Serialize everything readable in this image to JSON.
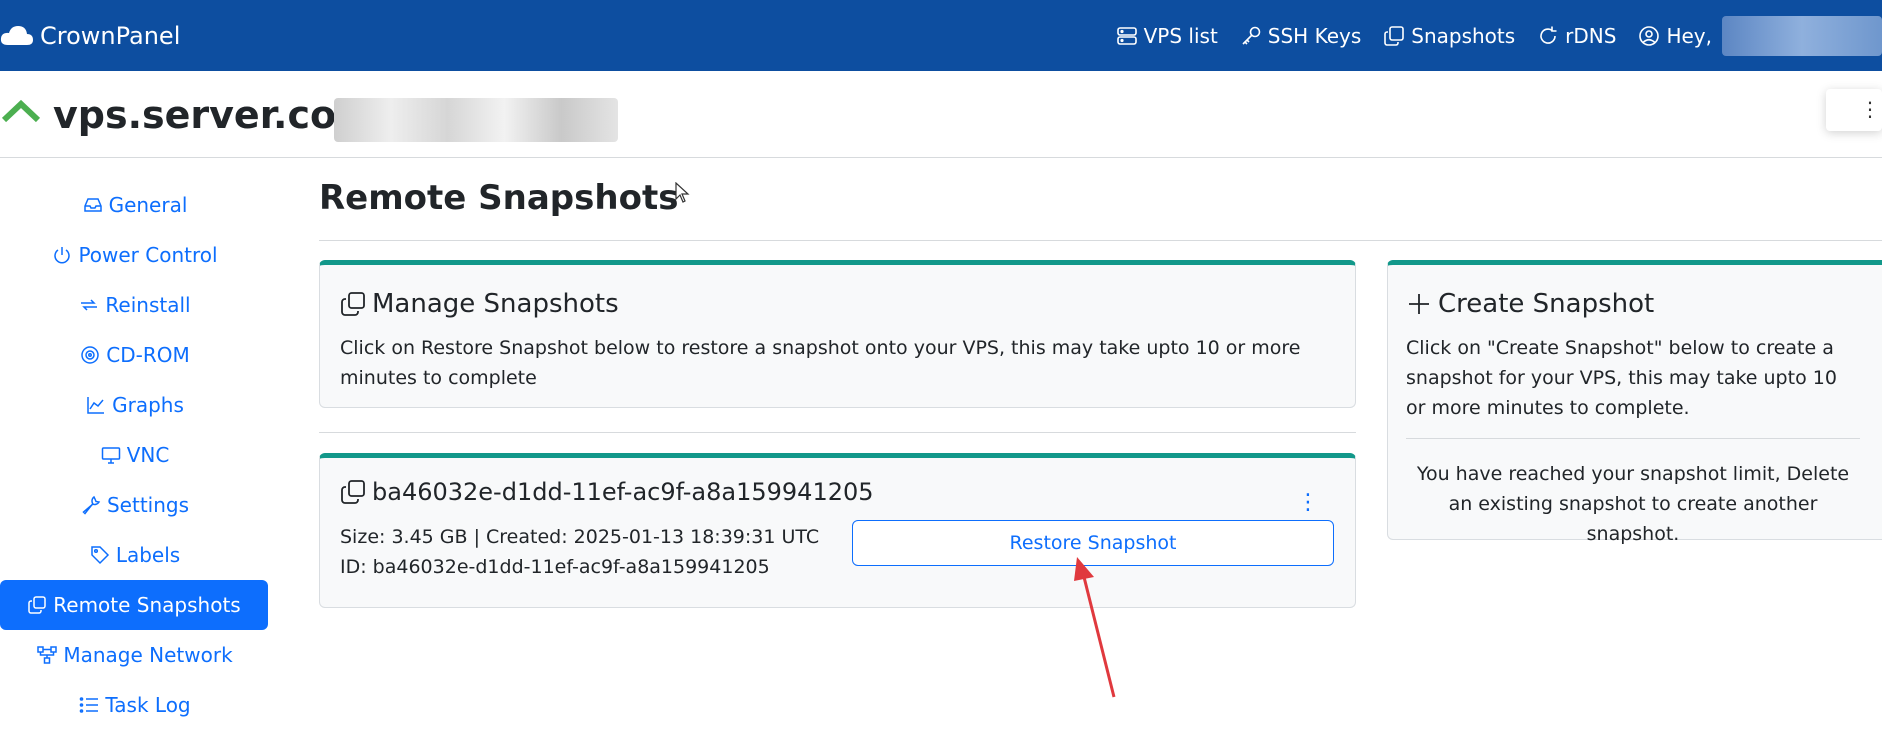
{
  "app": {
    "brand": "CrownPanel"
  },
  "nav": {
    "items": [
      {
        "label": "VPS list",
        "icon": "server-icon"
      },
      {
        "label": "SSH Keys",
        "icon": "key-icon"
      },
      {
        "label": "Snapshots",
        "icon": "copy-icon"
      },
      {
        "label": "rDNS",
        "icon": "refresh-icon"
      },
      {
        "label": "Hey,",
        "icon": "user-circle-icon"
      }
    ]
  },
  "header": {
    "hostname": "vps.server.com",
    "status_icon": "chevron-up-icon",
    "status_color": "#4caf50"
  },
  "sidebar": {
    "items": [
      {
        "label": "General",
        "icon": "inbox-icon"
      },
      {
        "label": "Power Control",
        "icon": "power-icon"
      },
      {
        "label": "Reinstall",
        "icon": "reinstall-icon"
      },
      {
        "label": "CD-ROM",
        "icon": "disc-icon"
      },
      {
        "label": "Graphs",
        "icon": "graph-icon"
      },
      {
        "label": "VNC",
        "icon": "monitor-icon"
      },
      {
        "label": "Settings",
        "icon": "wrench-icon"
      },
      {
        "label": "Labels",
        "icon": "tag-icon"
      },
      {
        "label": "Remote Snapshots",
        "icon": "copy-icon",
        "active": true
      },
      {
        "label": "Manage Network",
        "icon": "network-icon"
      },
      {
        "label": "Task Log",
        "icon": "list-icon"
      }
    ]
  },
  "main": {
    "title": "Remote Snapshots",
    "manage": {
      "heading": "Manage Snapshots",
      "text": "Click on Restore Snapshot below to restore a snapshot onto your VPS, this may take upto 10 or more minutes to complete"
    },
    "snapshot": {
      "name": "ba46032e-d1dd-11ef-ac9f-a8a159941205",
      "meta": "Size: 3.45 GB | Created: 2025-01-13 18:39:31 UTC",
      "id_line": "ID: ba46032e-d1dd-11ef-ac9f-a8a159941205",
      "restore_label": "Restore Snapshot",
      "menu_glyph": "⋮"
    },
    "create": {
      "heading": "Create Snapshot",
      "text": "Click on \"Create Snapshot\" below to create a snapshot for your VPS, this may take upto 10 or more minutes to complete.",
      "limit": "You have reached your snapshot limit, Delete an existing snapshot to create another snapshot."
    }
  },
  "colors": {
    "navbar": "#0d4ea0",
    "primary": "#0d6efd",
    "card_accent": "#12988a",
    "annotation_arrow": "#e0393e"
  }
}
